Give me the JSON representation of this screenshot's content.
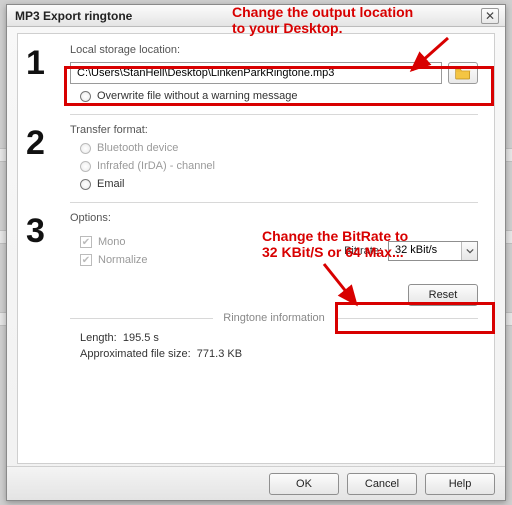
{
  "dialog": {
    "title": "MP3 Export ringtone"
  },
  "section1": {
    "number": "1",
    "label": "Local storage location:",
    "path": "C:\\Users\\StanHell\\Desktop\\LinkenParkRingtone.mp3",
    "overwrite_label": "Overwrite file without a warning message"
  },
  "section2": {
    "number": "2",
    "label": "Transfer format:",
    "bluetooth": "Bluetooth device",
    "infrared": "Infrafed (IrDA) - channel",
    "email": "Email"
  },
  "section3": {
    "number": "3",
    "label": "Options:",
    "mono": "Mono",
    "normalize": "Normalize",
    "bitrate_label": "Bit rate:",
    "bitrate_value": "32 kBit/s",
    "reset": "Reset"
  },
  "ringtone_info": {
    "header": "Ringtone information",
    "length_label": "Length:",
    "length_value": "195.5 s",
    "size_label": "Approximated file size:",
    "size_value": "771.3 KB"
  },
  "footer": {
    "ok": "OK",
    "cancel": "Cancel",
    "help": "Help"
  },
  "annotations": {
    "top_text": "Change the output location\nto your Desktop.",
    "bottom_text": "Change the BitRate to\n32 KBit/S or 64 Max..."
  }
}
